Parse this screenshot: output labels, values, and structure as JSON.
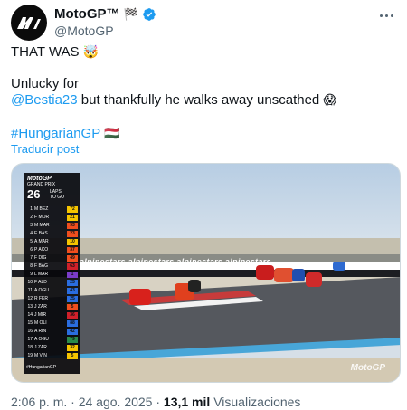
{
  "author": {
    "display_name": "MotoGP™",
    "flag_emoji": "🏁",
    "handle": "@MotoGP",
    "avatar_icon": "motogp-logo-icon"
  },
  "tweet": {
    "line1_text": "THAT WAS",
    "line1_emoji": "🤯",
    "line2_text": "Unlucky for",
    "mention": "@Bestia23",
    "line3_rest": "but thankfully he walks away unscathed",
    "line3_emoji": "😱",
    "hashtag": "#HungarianGP",
    "hashtag_flag": "🇭🇺",
    "translate_label": "Traducir post"
  },
  "media": {
    "ticker": {
      "logo": "MotoGP",
      "subtitle": "GRAND PRIX",
      "lap_number": "26",
      "laps_label": "LAPS",
      "to_go_label": "TO GO",
      "hashtag": "#HungarianGP",
      "rows": [
        {
          "pos": "1",
          "rider": "M BEZ",
          "num": "72",
          "color": "#f5c400"
        },
        {
          "pos": "2",
          "rider": "F MOR",
          "num": "21",
          "color": "#f5c400"
        },
        {
          "pos": "3",
          "rider": "M MAR",
          "num": "93",
          "color": "#f04e1e"
        },
        {
          "pos": "4",
          "rider": "E BAS",
          "num": "23",
          "color": "#f04e1e"
        },
        {
          "pos": "5",
          "rider": "A MAR",
          "num": "10",
          "color": "#f5c400"
        },
        {
          "pos": "6",
          "rider": "P ACO",
          "num": "37",
          "color": "#f04e1e"
        },
        {
          "pos": "7",
          "rider": "F DIG",
          "num": "49",
          "color": "#f04e1e"
        },
        {
          "pos": "8",
          "rider": "F BAG",
          "num": "63",
          "color": "#d0202a"
        },
        {
          "pos": "9",
          "rider": "L MAR",
          "num": "1",
          "color": "#7a3cc8"
        },
        {
          "pos": "10",
          "rider": "F ALD",
          "num": "25",
          "color": "#2a6de0"
        },
        {
          "pos": "11",
          "rider": "A OGU",
          "num": "43",
          "color": "#2a6de0"
        },
        {
          "pos": "12",
          "rider": "R FER",
          "num": "25",
          "color": "#2a6de0"
        },
        {
          "pos": "13",
          "rider": "J ZAR",
          "num": "5",
          "color": "#f04e1e"
        },
        {
          "pos": "14",
          "rider": "J MIR",
          "num": "36",
          "color": "#d0202a"
        },
        {
          "pos": "15",
          "rider": "M OLI",
          "num": "88",
          "color": "#2a6de0"
        },
        {
          "pos": "16",
          "rider": "A RIN",
          "num": "42",
          "color": "#2a6de0"
        },
        {
          "pos": "17",
          "rider": "A OGU",
          "num": "79",
          "color": "#2a8a4a"
        },
        {
          "pos": "18",
          "rider": "J ZAR",
          "num": "32",
          "color": "#f5c400"
        },
        {
          "pos": "19",
          "rider": "M VIN",
          "num": "5",
          "color": "#f5c400"
        }
      ]
    },
    "banner_text": "alpinestars",
    "watermark": "MotoGP"
  },
  "footer": {
    "time": "2:06 p. m.",
    "separator": "·",
    "date": "24 ago. 2025",
    "views_count": "13,1 mil",
    "views_label": "Visualizaciones"
  }
}
